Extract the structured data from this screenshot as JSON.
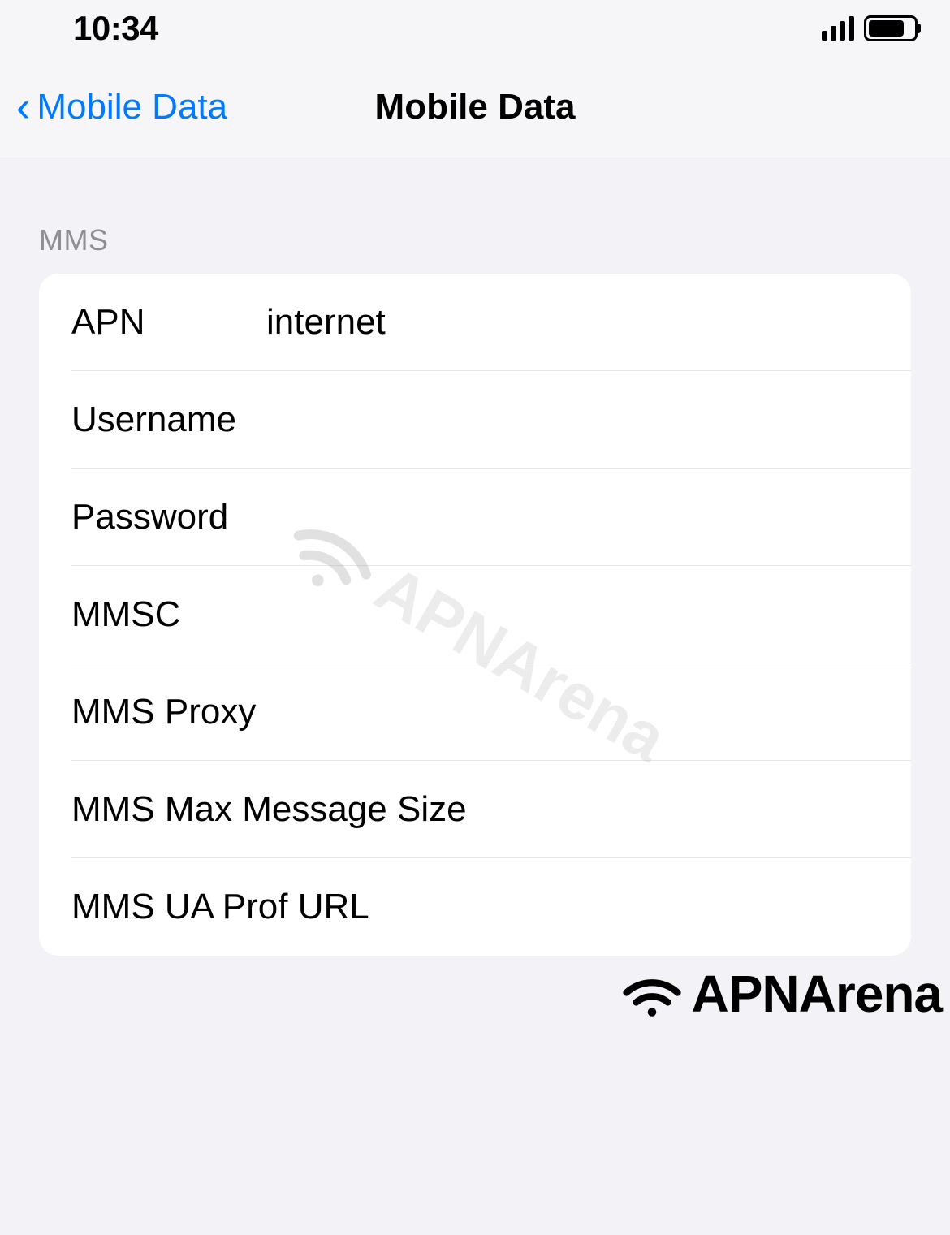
{
  "statusBar": {
    "time": "10:34"
  },
  "navBar": {
    "backLabel": "Mobile Data",
    "title": "Mobile Data"
  },
  "section": {
    "header": "MMS",
    "rows": [
      {
        "label": "APN",
        "value": "internet"
      },
      {
        "label": "Username",
        "value": ""
      },
      {
        "label": "Password",
        "value": ""
      },
      {
        "label": "MMSC",
        "value": ""
      },
      {
        "label": "MMS Proxy",
        "value": ""
      },
      {
        "label": "MMS Max Message Size",
        "value": ""
      },
      {
        "label": "MMS UA Prof URL",
        "value": ""
      }
    ]
  },
  "watermark": {
    "text": "APNArena"
  },
  "footer": {
    "brand": "APNArena"
  }
}
